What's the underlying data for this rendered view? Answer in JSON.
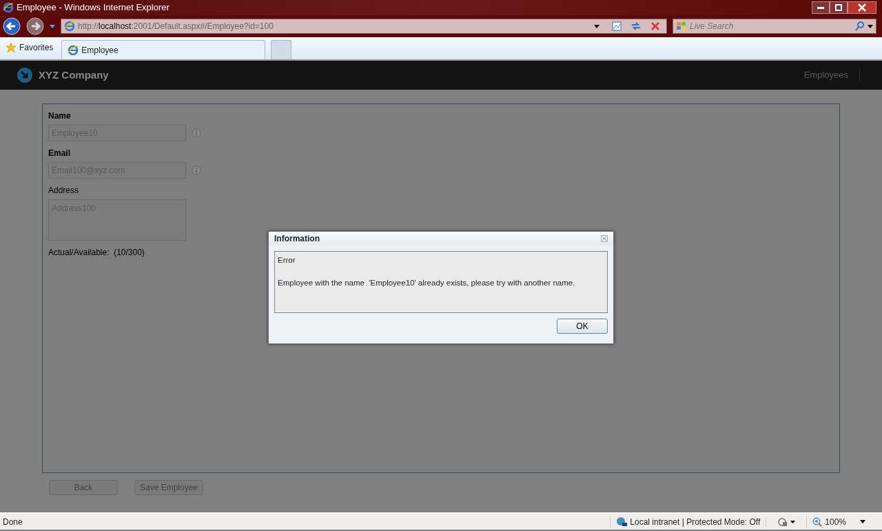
{
  "window": {
    "title": "Employee - Windows Internet Explorer"
  },
  "address_bar": {
    "url": "http://**localhost**:2001/Default.aspx#/Employee?id=100"
  },
  "search": {
    "placeholder": "Live Search"
  },
  "favorites": "Favorites",
  "tabs": [
    {
      "label": "Employee",
      "selected": true
    }
  ],
  "app": {
    "brand": "XYZ Company",
    "nav": [
      "Employees"
    ]
  },
  "form": {
    "fields": [
      {
        "label": "Name",
        "value": "Employee10",
        "kind": "text",
        "required": true
      },
      {
        "label": "Email",
        "value": "Email100@xyz.com",
        "kind": "text",
        "required": true
      },
      {
        "label": "Address",
        "value": "Address100",
        "kind": "textarea",
        "required": false
      }
    ],
    "counter": "Actual/Available:  (10/300)",
    "buttons": [
      "Back",
      "Save Employee"
    ]
  },
  "dialog": {
    "title": "Information",
    "heading": "Error",
    "message": "Employee with the name  'Employee10' already exists, please try with another name.",
    "button": "OK"
  },
  "status_bar": {
    "text": "Done",
    "zone": "Local intranet | Protected Mode: Off",
    "zoom": "100%"
  }
}
